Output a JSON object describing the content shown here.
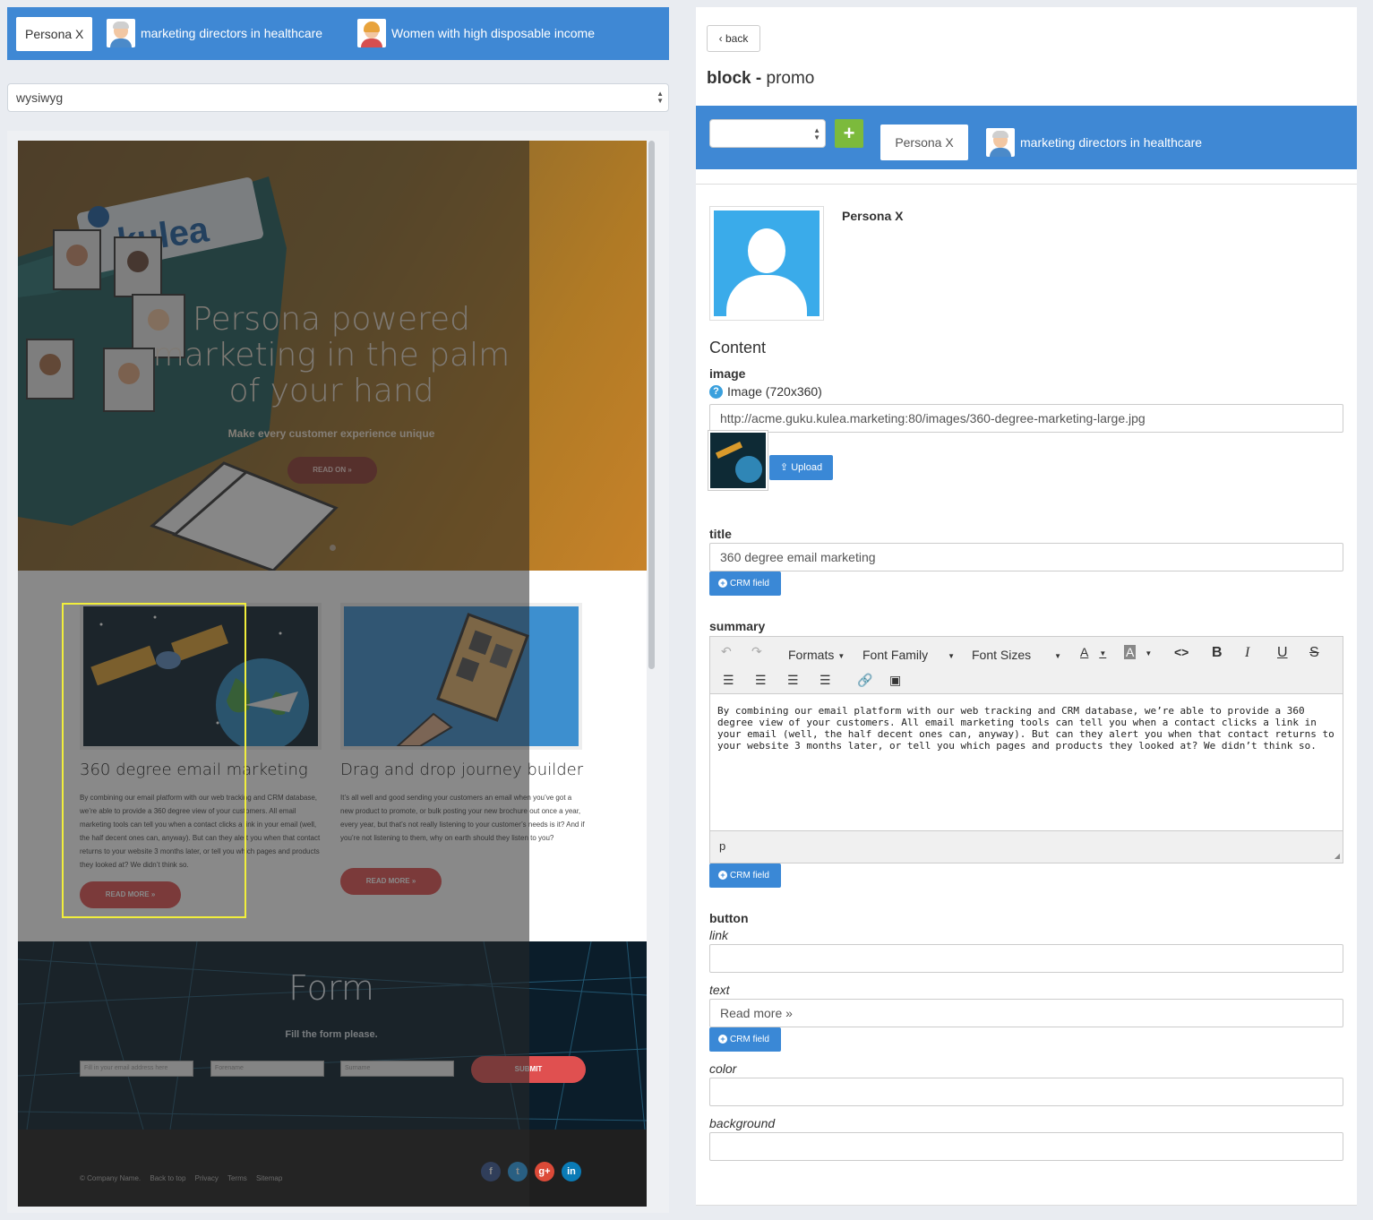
{
  "left": {
    "persona_bar": {
      "active": "Persona X",
      "personas": [
        {
          "label": "marketing directors in healthcare",
          "avatar": "man-avatar"
        },
        {
          "label": "Women with high disposable income",
          "avatar": "woman-avatar"
        }
      ]
    },
    "mode_select": {
      "value": "wysiwyg"
    },
    "preview": {
      "hero": {
        "logo": "kulea",
        "title": "Persona powered marketing in the palm of your hand",
        "subtitle": "Make every customer experience unique",
        "button": "READ ON »"
      },
      "cards": [
        {
          "title": "360 degree email marketing",
          "text": "By combining our email platform with our web tracking and CRM database, we’re able to provide a 360 degree view of your customers. All email marketing tools can tell you when a contact clicks a link in your email (well, the half decent ones can, anyway). But can they alert you when that contact returns to your website 3 months later, or tell you which pages and products they looked at? We didn’t think so.",
          "button": "READ MORE »"
        },
        {
          "title": "Drag and drop journey builder",
          "text": "It’s all well and good sending your customers an email when you’ve got a new product to promote, or bulk posting your new brochure out once a year, every year, but that’s not really listening to your customer’s needs is it? And if you’re not listening to them, why on earth should they listen to you?",
          "button": "READ MORE »"
        }
      ],
      "form": {
        "title": "Form",
        "subtitle": "Fill the form please.",
        "email_placeholder": "Fill in your email address here",
        "forename_placeholder": "Forename",
        "surname_placeholder": "Surname",
        "submit": "SUBMIT"
      },
      "footer": {
        "links": [
          "© Company Name.",
          "Back to top",
          "Privacy",
          "Terms",
          "Sitemap"
        ],
        "social": [
          {
            "label": "f",
            "color": "#3b5998"
          },
          {
            "label": "t",
            "color": "#2aa3ef"
          },
          {
            "label": "g+",
            "color": "#dc4a38"
          },
          {
            "label": "in",
            "color": "#0a7bb6"
          }
        ]
      }
    }
  },
  "right": {
    "back_label": "back",
    "block_label": "block -",
    "block_name": "promo",
    "persona_bar": {
      "plus": "+",
      "active": "Persona X",
      "persona": "marketing directors in healthcare"
    },
    "persona_name": "Persona X",
    "content_heading": "Content",
    "image": {
      "label": "image",
      "help": "Image (720x360)",
      "url": "http://acme.guku.kulea.marketing:80/images/360-degree-marketing-large.jpg",
      "upload": "Upload"
    },
    "title": {
      "label": "title",
      "value": "360 degree email marketing",
      "crm": "CRM field"
    },
    "summary": {
      "label": "summary",
      "toolbar": {
        "formats": "Formats",
        "font_family": "Font Family",
        "font_sizes": "Font Sizes",
        "text_color": "A",
        "bg_color": "A",
        "code": "<>",
        "bold": "B",
        "italic": "I",
        "underline": "U",
        "strike": "S"
      },
      "body": "By combining our email platform with our web tracking and CRM database, we’re able to provide a 360 degree view of your customers. All email marketing tools can tell you when a contact clicks a link in your email (well, the half decent ones can, anyway). But can they alert you when that contact returns to your website 3 months later, or tell you which pages and products they looked at? We didn’t think so.",
      "status": "p",
      "crm": "CRM field"
    },
    "button": {
      "label": "button",
      "link_label": "link",
      "link_value": "",
      "text_label": "text",
      "text_value": "Read more »",
      "crm": "CRM field",
      "color_label": "color",
      "color_value": "",
      "background_label": "background",
      "background_value": ""
    }
  }
}
